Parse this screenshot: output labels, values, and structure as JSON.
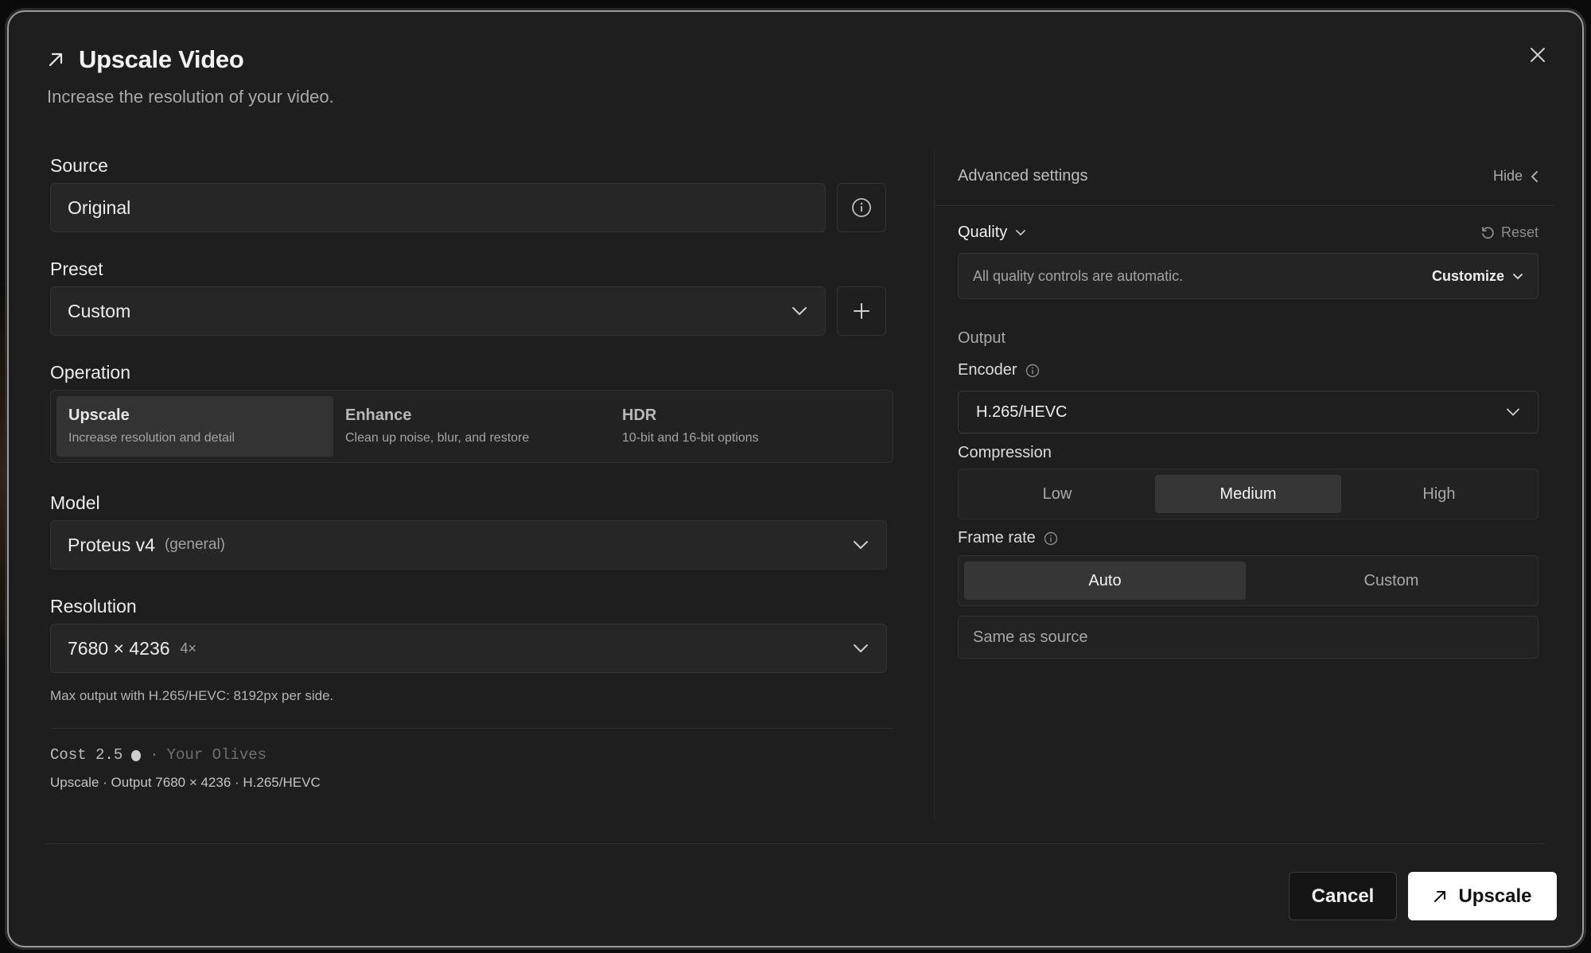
{
  "dialog": {
    "title": "Upscale Video",
    "subtitle": "Increase the resolution of your video."
  },
  "source": {
    "label": "Source",
    "value": "Original"
  },
  "preset": {
    "label": "Preset",
    "value": "Custom"
  },
  "operation": {
    "label": "Operation",
    "options": [
      {
        "title": "Upscale",
        "desc": "Increase resolution and detail",
        "selected": true
      },
      {
        "title": "Enhance",
        "desc": "Clean up noise, blur, and restore",
        "selected": false
      },
      {
        "title": "HDR",
        "desc": "10-bit and 16-bit options",
        "selected": false
      }
    ]
  },
  "model": {
    "label": "Model",
    "name": "Proteus v4",
    "tag": "(general)"
  },
  "resolution": {
    "label": "Resolution",
    "value": "7680 × 4236",
    "factor": "4×",
    "note": "Max output with H.265/HEVC: 8192px per side."
  },
  "cost": {
    "label": "Cost 2.5",
    "sep": "·",
    "unit": "Your Olives",
    "summary": "Upscale · Output 7680 × 4236 · H.265/HEVC"
  },
  "advanced": {
    "title": "Advanced settings",
    "hide_label": "Hide",
    "quality_label": "Quality",
    "reset_label": "Reset",
    "auto_text": "All quality controls are automatic.",
    "customize_label": "Customize",
    "output_label": "Output",
    "encoder_label": "Encoder",
    "encoder_value": "H.265/HEVC",
    "compression_label": "Compression",
    "compression_options": [
      "Low",
      "Medium",
      "High"
    ],
    "compression_selected": "Medium",
    "framerate_label": "Frame rate",
    "framerate_options": [
      "Auto",
      "Custom"
    ],
    "framerate_selected": "Auto",
    "framerate_value": "Same as source"
  },
  "footer": {
    "cancel_label": "Cancel",
    "upscale_label": "Upscale"
  }
}
